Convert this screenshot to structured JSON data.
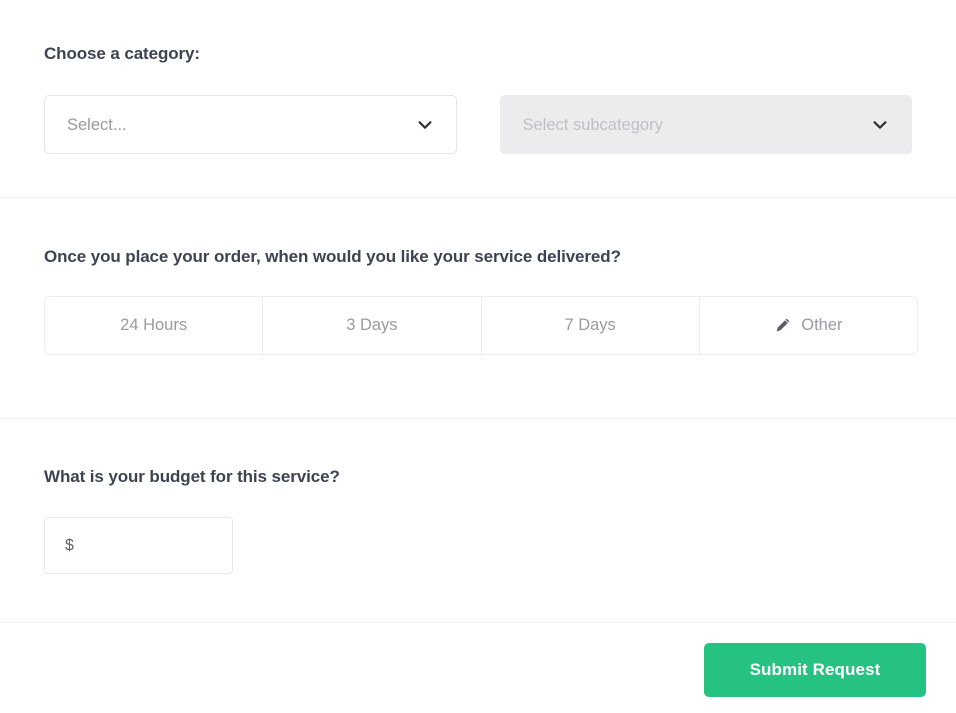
{
  "form": {
    "category_section": {
      "label": "Choose a category:",
      "category_select": {
        "value": "Select...",
        "icon": "chevron-down-icon",
        "state": "enabled"
      },
      "subcategory_select": {
        "value": "Select subcategory",
        "icon": "chevron-down-icon",
        "state": "disabled"
      }
    },
    "delivery_section": {
      "label": "Once you place your order, when would you like your service delivered?",
      "options": [
        {
          "label": "24 Hours",
          "icon": ""
        },
        {
          "label": "3 Days",
          "icon": ""
        },
        {
          "label": "7 Days",
          "icon": ""
        },
        {
          "label": "Other",
          "icon": "pencil-icon"
        }
      ]
    },
    "budget_section": {
      "label": "What is your budget for this service?",
      "currency_symbol": "$",
      "value": "",
      "placeholder": ""
    },
    "footer": {
      "submit_label": "Submit Request"
    }
  },
  "colors": {
    "accent_green": "#26c281",
    "heading_text": "#3d4350",
    "muted_text": "#9b9b9f",
    "border": "#e3e5e8",
    "disabled_bg": "#ececee",
    "divider": "#f0f1f2"
  }
}
